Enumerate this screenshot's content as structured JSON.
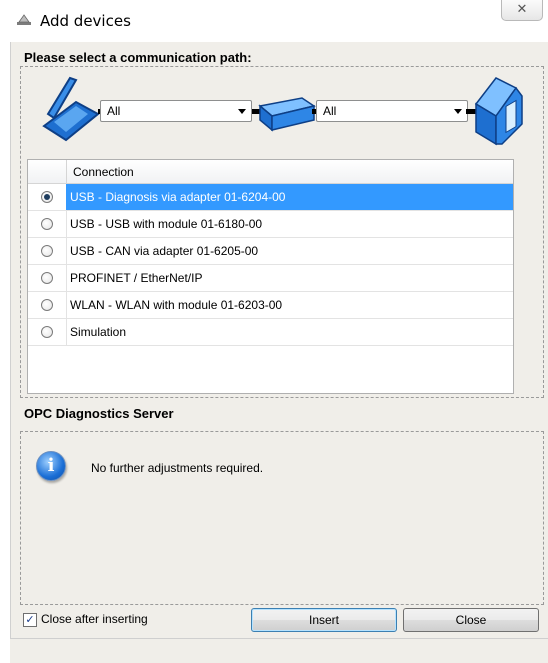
{
  "window": {
    "title": "Add devices",
    "close_glyph": "✕"
  },
  "path_section": {
    "label": "Please select a communication path:",
    "combo1_value": "All",
    "combo2_value": "All",
    "icons": [
      "laptop-icon",
      "adapter-icon",
      "device-icon"
    ]
  },
  "grid": {
    "header": "Connection",
    "rows": [
      {
        "label": "USB - Diagnosis via adapter 01-6204-00",
        "selected": true
      },
      {
        "label": "USB - USB with module 01-6180-00",
        "selected": false
      },
      {
        "label": "USB - CAN via adapter 01-6205-00",
        "selected": false
      },
      {
        "label": "PROFINET / EtherNet/IP",
        "selected": false
      },
      {
        "label": "WLAN - WLAN with module 01-6203-00",
        "selected": false
      },
      {
        "label": "Simulation",
        "selected": false
      }
    ]
  },
  "server_section": {
    "label": "OPC Diagnostics Server",
    "info_glyph": "i",
    "message": "No further adjustments required."
  },
  "footer": {
    "close_after_label": "Close after inserting",
    "close_after_checked": true,
    "check_glyph": "✓",
    "insert_label": "Insert",
    "close_label": "Close"
  },
  "colors": {
    "selection": "#3399ff",
    "panel_bg": "#f0eee9",
    "icon_blue": "#1e6fd0"
  }
}
